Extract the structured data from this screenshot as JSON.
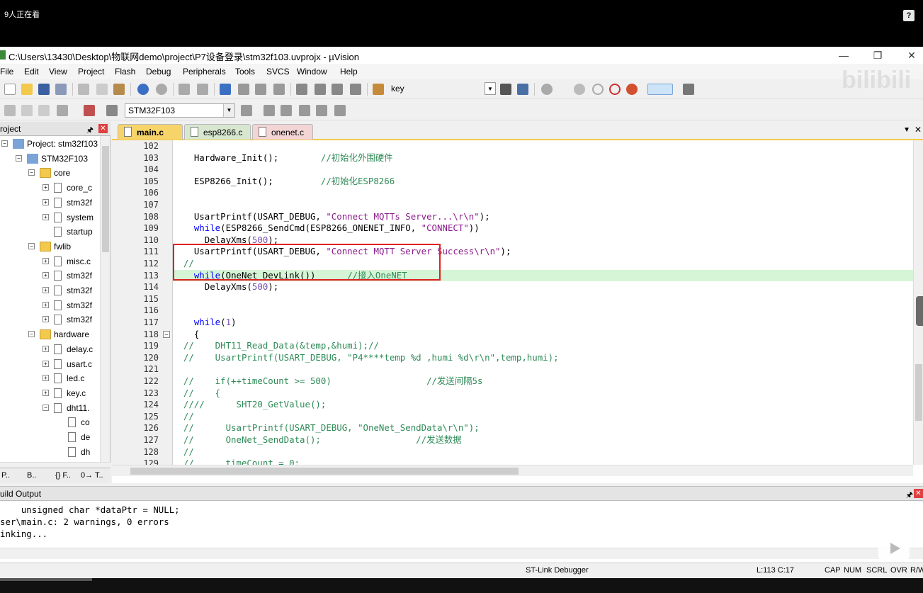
{
  "overlay": {
    "viewers": "9人正在看",
    "help": "?",
    "watermark": "bilibili"
  },
  "window": {
    "title": "C:\\Users\\13430\\Desktop\\物联网demo\\project\\P7设备登录\\stm32f103.uvprojx - µVision"
  },
  "menu": [
    "File",
    "Edit",
    "View",
    "Project",
    "Flash",
    "Debug",
    "Peripherals",
    "Tools",
    "SVCS",
    "Window",
    "Help"
  ],
  "toolbar": {
    "find_combo": "key",
    "target_combo": "STM32F103"
  },
  "project_panel": {
    "title": "roject",
    "tree": [
      {
        "label": "Project: stm32f103",
        "level": 0,
        "kind": "proj",
        "exp": "−"
      },
      {
        "label": "STM32F103",
        "level": 1,
        "kind": "proj",
        "exp": "−"
      },
      {
        "label": "core",
        "level": 2,
        "kind": "folder",
        "exp": "−"
      },
      {
        "label": "core_c",
        "level": 3,
        "kind": "file",
        "exp": "+"
      },
      {
        "label": "stm32f",
        "level": 3,
        "kind": "file",
        "exp": "+"
      },
      {
        "label": "system",
        "level": 3,
        "kind": "file",
        "exp": "+"
      },
      {
        "label": "startup",
        "level": 3,
        "kind": "file",
        "exp": ""
      },
      {
        "label": "fwlib",
        "level": 2,
        "kind": "folder",
        "exp": "−"
      },
      {
        "label": "misc.c",
        "level": 3,
        "kind": "file",
        "exp": "+"
      },
      {
        "label": "stm32f",
        "level": 3,
        "kind": "file",
        "exp": "+"
      },
      {
        "label": "stm32f",
        "level": 3,
        "kind": "file",
        "exp": "+"
      },
      {
        "label": "stm32f",
        "level": 3,
        "kind": "file",
        "exp": "+"
      },
      {
        "label": "stm32f",
        "level": 3,
        "kind": "file",
        "exp": "+"
      },
      {
        "label": "hardware",
        "level": 2,
        "kind": "folder",
        "exp": "−"
      },
      {
        "label": "delay.c",
        "level": 3,
        "kind": "file",
        "exp": "+"
      },
      {
        "label": "usart.c",
        "level": 3,
        "kind": "file",
        "exp": "+"
      },
      {
        "label": "led.c",
        "level": 3,
        "kind": "file",
        "exp": "+"
      },
      {
        "label": "key.c",
        "level": 3,
        "kind": "file",
        "exp": "+"
      },
      {
        "label": "dht11.",
        "level": 3,
        "kind": "file",
        "exp": "−"
      },
      {
        "label": "co",
        "level": 4,
        "kind": "file",
        "exp": ""
      },
      {
        "label": "de",
        "level": 4,
        "kind": "file",
        "exp": ""
      },
      {
        "label": "dh",
        "level": 4,
        "kind": "file",
        "exp": ""
      }
    ],
    "bottom_tabs": [
      "P..",
      "B..",
      "{} F..",
      "0→ T.."
    ]
  },
  "editor": {
    "tabs": [
      "main.c",
      "esp8266.c",
      "onenet.c"
    ],
    "lines": [
      {
        "n": "102",
        "parts": []
      },
      {
        "n": "103",
        "parts": [
          {
            "t": "    Hardware_Init();        ",
            "c": "txt"
          },
          {
            "t": "//初始化外围硬件",
            "c": "com"
          }
        ]
      },
      {
        "n": "104",
        "parts": []
      },
      {
        "n": "105",
        "parts": [
          {
            "t": "    ESP8266_Init();         ",
            "c": "txt"
          },
          {
            "t": "//初始化ESP8266",
            "c": "com"
          }
        ]
      },
      {
        "n": "106",
        "parts": []
      },
      {
        "n": "107",
        "parts": []
      },
      {
        "n": "108",
        "parts": [
          {
            "t": "    UsartPrintf(USART_DEBUG, ",
            "c": "txt"
          },
          {
            "t": "\"Connect MQTTs Server...\\r\\n\"",
            "c": "str"
          },
          {
            "t": ");",
            "c": "txt"
          }
        ]
      },
      {
        "n": "109",
        "parts": [
          {
            "t": "    ",
            "c": "txt"
          },
          {
            "t": "while",
            "c": "kw"
          },
          {
            "t": "(ESP8266_SendCmd(ESP8266_ONENET_INFO, ",
            "c": "txt"
          },
          {
            "t": "\"CONNECT\"",
            "c": "str"
          },
          {
            "t": "))",
            "c": "txt"
          }
        ]
      },
      {
        "n": "110",
        "parts": [
          {
            "t": "      DelayXms(",
            "c": "txt"
          },
          {
            "t": "500",
            "c": "num"
          },
          {
            "t": ");",
            "c": "txt"
          }
        ]
      },
      {
        "n": "111",
        "parts": [
          {
            "t": "    UsartPrintf(USART_DEBUG, ",
            "c": "txt"
          },
          {
            "t": "\"Connect MQTT Server Success\\r\\n\"",
            "c": "str"
          },
          {
            "t": ");",
            "c": "txt"
          }
        ]
      },
      {
        "n": "112",
        "parts": [
          {
            "t": "  //",
            "c": "com"
          }
        ]
      },
      {
        "n": "113",
        "hl": true,
        "parts": [
          {
            "t": "    ",
            "c": "txt"
          },
          {
            "t": "while",
            "c": "kw"
          },
          {
            "t": "(OneNet_DevLink())      ",
            "c": "txt"
          },
          {
            "t": "//接入OneNET",
            "c": "com"
          }
        ]
      },
      {
        "n": "114",
        "parts": [
          {
            "t": "      DelayXms(",
            "c": "txt"
          },
          {
            "t": "500",
            "c": "num"
          },
          {
            "t": ");",
            "c": "txt"
          }
        ]
      },
      {
        "n": "115",
        "parts": []
      },
      {
        "n": "116",
        "parts": []
      },
      {
        "n": "117",
        "parts": [
          {
            "t": "    ",
            "c": "txt"
          },
          {
            "t": "while",
            "c": "kw"
          },
          {
            "t": "(",
            "c": "txt"
          },
          {
            "t": "1",
            "c": "num"
          },
          {
            "t": ")",
            "c": "txt"
          }
        ]
      },
      {
        "n": "118",
        "fold": true,
        "parts": [
          {
            "t": "    {",
            "c": "txt"
          }
        ]
      },
      {
        "n": "119",
        "parts": [
          {
            "t": "  //    DHT11_Read_Data(&temp,&humi);//",
            "c": "com"
          }
        ]
      },
      {
        "n": "120",
        "parts": [
          {
            "t": "  //    UsartPrintf(USART_DEBUG, \"P4****temp %d ,humi %d\\r\\n\",temp,humi);",
            "c": "com"
          }
        ]
      },
      {
        "n": "121",
        "parts": []
      },
      {
        "n": "122",
        "parts": [
          {
            "t": "  //    if(++timeCount >= 500)                  //发送间隔5s",
            "c": "com"
          }
        ]
      },
      {
        "n": "123",
        "parts": [
          {
            "t": "  //    {",
            "c": "com"
          }
        ]
      },
      {
        "n": "124",
        "parts": [
          {
            "t": "  ////      SHT20_GetValue();",
            "c": "com"
          }
        ]
      },
      {
        "n": "125",
        "parts": [
          {
            "t": "  //",
            "c": "com"
          }
        ]
      },
      {
        "n": "126",
        "parts": [
          {
            "t": "  //      UsartPrintf(USART_DEBUG, \"OneNet_SendData\\r\\n\");",
            "c": "com"
          }
        ]
      },
      {
        "n": "127",
        "parts": [
          {
            "t": "  //      OneNet_SendData();                  //发送数据",
            "c": "com"
          }
        ]
      },
      {
        "n": "128",
        "parts": [
          {
            "t": "  //",
            "c": "com"
          }
        ]
      },
      {
        "n": "129",
        "parts": [
          {
            "t": "  //      timeCount = 0;",
            "c": "com"
          }
        ]
      }
    ]
  },
  "build_output": {
    "title": "uild Output",
    "lines": [
      "    unsigned char *dataPtr = NULL;",
      "ser\\main.c: 2 warnings, 0 errors",
      "inking..."
    ]
  },
  "statusbar": {
    "debugger": "ST-Link Debugger",
    "position": "L:113 C:17",
    "caps": "CAP",
    "num": "NUM",
    "scrl": "SCRL",
    "ovr": "OVR",
    "rw": "R/W"
  }
}
